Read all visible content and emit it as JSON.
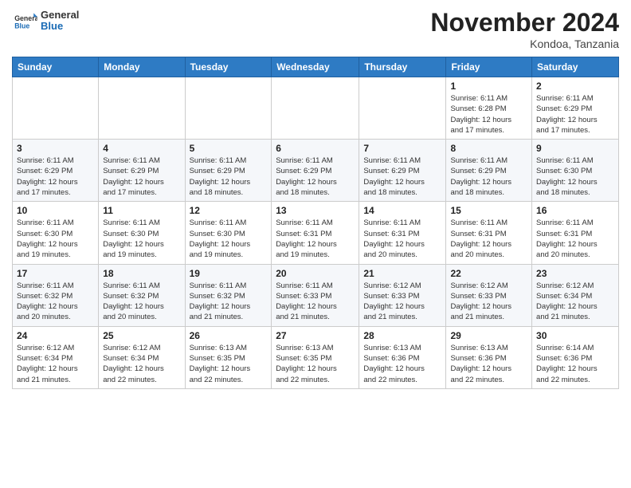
{
  "header": {
    "logo": {
      "general": "General",
      "blue": "Blue"
    },
    "title": "November 2024",
    "location": "Kondoa, Tanzania"
  },
  "weekdays": [
    "Sunday",
    "Monday",
    "Tuesday",
    "Wednesday",
    "Thursday",
    "Friday",
    "Saturday"
  ],
  "weeks": [
    [
      {
        "day": "",
        "info": ""
      },
      {
        "day": "",
        "info": ""
      },
      {
        "day": "",
        "info": ""
      },
      {
        "day": "",
        "info": ""
      },
      {
        "day": "",
        "info": ""
      },
      {
        "day": "1",
        "info": "Sunrise: 6:11 AM\nSunset: 6:28 PM\nDaylight: 12 hours\nand 17 minutes."
      },
      {
        "day": "2",
        "info": "Sunrise: 6:11 AM\nSunset: 6:29 PM\nDaylight: 12 hours\nand 17 minutes."
      }
    ],
    [
      {
        "day": "3",
        "info": "Sunrise: 6:11 AM\nSunset: 6:29 PM\nDaylight: 12 hours\nand 17 minutes."
      },
      {
        "day": "4",
        "info": "Sunrise: 6:11 AM\nSunset: 6:29 PM\nDaylight: 12 hours\nand 17 minutes."
      },
      {
        "day": "5",
        "info": "Sunrise: 6:11 AM\nSunset: 6:29 PM\nDaylight: 12 hours\nand 18 minutes."
      },
      {
        "day": "6",
        "info": "Sunrise: 6:11 AM\nSunset: 6:29 PM\nDaylight: 12 hours\nand 18 minutes."
      },
      {
        "day": "7",
        "info": "Sunrise: 6:11 AM\nSunset: 6:29 PM\nDaylight: 12 hours\nand 18 minutes."
      },
      {
        "day": "8",
        "info": "Sunrise: 6:11 AM\nSunset: 6:29 PM\nDaylight: 12 hours\nand 18 minutes."
      },
      {
        "day": "9",
        "info": "Sunrise: 6:11 AM\nSunset: 6:30 PM\nDaylight: 12 hours\nand 18 minutes."
      }
    ],
    [
      {
        "day": "10",
        "info": "Sunrise: 6:11 AM\nSunset: 6:30 PM\nDaylight: 12 hours\nand 19 minutes."
      },
      {
        "day": "11",
        "info": "Sunrise: 6:11 AM\nSunset: 6:30 PM\nDaylight: 12 hours\nand 19 minutes."
      },
      {
        "day": "12",
        "info": "Sunrise: 6:11 AM\nSunset: 6:30 PM\nDaylight: 12 hours\nand 19 minutes."
      },
      {
        "day": "13",
        "info": "Sunrise: 6:11 AM\nSunset: 6:31 PM\nDaylight: 12 hours\nand 19 minutes."
      },
      {
        "day": "14",
        "info": "Sunrise: 6:11 AM\nSunset: 6:31 PM\nDaylight: 12 hours\nand 20 minutes."
      },
      {
        "day": "15",
        "info": "Sunrise: 6:11 AM\nSunset: 6:31 PM\nDaylight: 12 hours\nand 20 minutes."
      },
      {
        "day": "16",
        "info": "Sunrise: 6:11 AM\nSunset: 6:31 PM\nDaylight: 12 hours\nand 20 minutes."
      }
    ],
    [
      {
        "day": "17",
        "info": "Sunrise: 6:11 AM\nSunset: 6:32 PM\nDaylight: 12 hours\nand 20 minutes."
      },
      {
        "day": "18",
        "info": "Sunrise: 6:11 AM\nSunset: 6:32 PM\nDaylight: 12 hours\nand 20 minutes."
      },
      {
        "day": "19",
        "info": "Sunrise: 6:11 AM\nSunset: 6:32 PM\nDaylight: 12 hours\nand 21 minutes."
      },
      {
        "day": "20",
        "info": "Sunrise: 6:11 AM\nSunset: 6:33 PM\nDaylight: 12 hours\nand 21 minutes."
      },
      {
        "day": "21",
        "info": "Sunrise: 6:12 AM\nSunset: 6:33 PM\nDaylight: 12 hours\nand 21 minutes."
      },
      {
        "day": "22",
        "info": "Sunrise: 6:12 AM\nSunset: 6:33 PM\nDaylight: 12 hours\nand 21 minutes."
      },
      {
        "day": "23",
        "info": "Sunrise: 6:12 AM\nSunset: 6:34 PM\nDaylight: 12 hours\nand 21 minutes."
      }
    ],
    [
      {
        "day": "24",
        "info": "Sunrise: 6:12 AM\nSunset: 6:34 PM\nDaylight: 12 hours\nand 21 minutes."
      },
      {
        "day": "25",
        "info": "Sunrise: 6:12 AM\nSunset: 6:34 PM\nDaylight: 12 hours\nand 22 minutes."
      },
      {
        "day": "26",
        "info": "Sunrise: 6:13 AM\nSunset: 6:35 PM\nDaylight: 12 hours\nand 22 minutes."
      },
      {
        "day": "27",
        "info": "Sunrise: 6:13 AM\nSunset: 6:35 PM\nDaylight: 12 hours\nand 22 minutes."
      },
      {
        "day": "28",
        "info": "Sunrise: 6:13 AM\nSunset: 6:36 PM\nDaylight: 12 hours\nand 22 minutes."
      },
      {
        "day": "29",
        "info": "Sunrise: 6:13 AM\nSunset: 6:36 PM\nDaylight: 12 hours\nand 22 minutes."
      },
      {
        "day": "30",
        "info": "Sunrise: 6:14 AM\nSunset: 6:36 PM\nDaylight: 12 hours\nand 22 minutes."
      }
    ]
  ]
}
